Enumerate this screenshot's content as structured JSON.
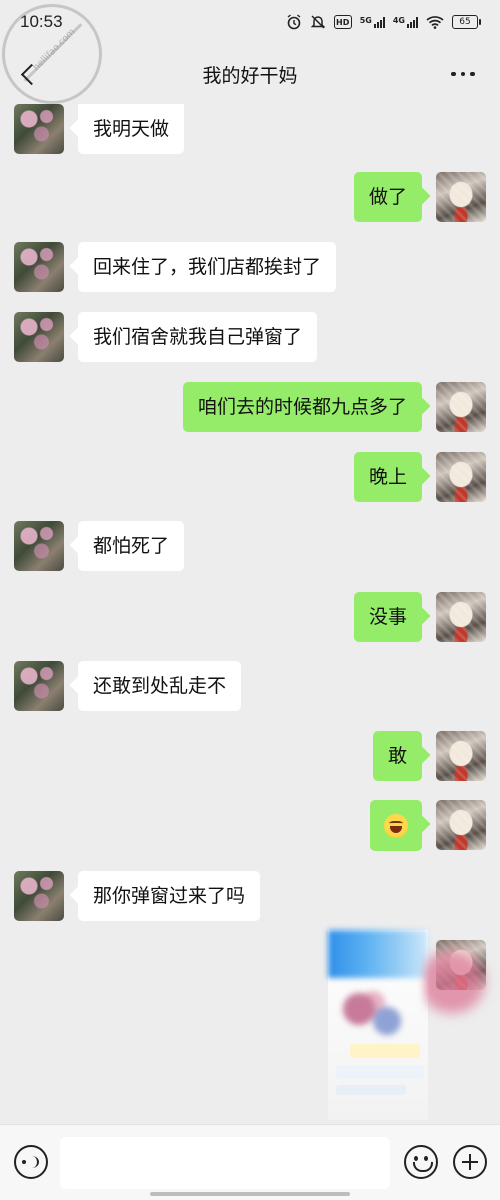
{
  "status_bar": {
    "time": "10:53",
    "icons": [
      "alarm-icon",
      "mute-icon",
      "hd-icon",
      "signal-5g-icon",
      "signal-4g-icon",
      "wifi-icon",
      "battery-icon"
    ],
    "hd_label": "HD",
    "net1_label": "5G",
    "net2_label": "4G",
    "battery_level": "65"
  },
  "watermark": {
    "text": "hellifao.com"
  },
  "header": {
    "title": "我的好干妈"
  },
  "messages": [
    {
      "sender": "her",
      "text": "我明天做"
    },
    {
      "sender": "me",
      "text": "做了"
    },
    {
      "sender": "her",
      "text": "回来住了，我们店都挨封了"
    },
    {
      "sender": "her",
      "text": "我们宿舍就我自己弹窗了"
    },
    {
      "sender": "me",
      "text": "咱们去的时候都九点多了"
    },
    {
      "sender": "me",
      "text": "晚上"
    },
    {
      "sender": "her",
      "text": "都怕死了"
    },
    {
      "sender": "me",
      "text": "没事"
    },
    {
      "sender": "her",
      "text": "还敢到处乱走不"
    },
    {
      "sender": "me",
      "text": "敢"
    },
    {
      "sender": "me",
      "emoji": "grinning-squinting-face-emoji"
    },
    {
      "sender": "her",
      "text": "那你弹窗过来了吗"
    },
    {
      "sender": "me",
      "type": "image"
    }
  ],
  "input_bar": {
    "placeholder": "",
    "value": ""
  },
  "colors": {
    "background": "#ededed",
    "my_bubble": "#95ec69",
    "their_bubble": "#ffffff"
  }
}
